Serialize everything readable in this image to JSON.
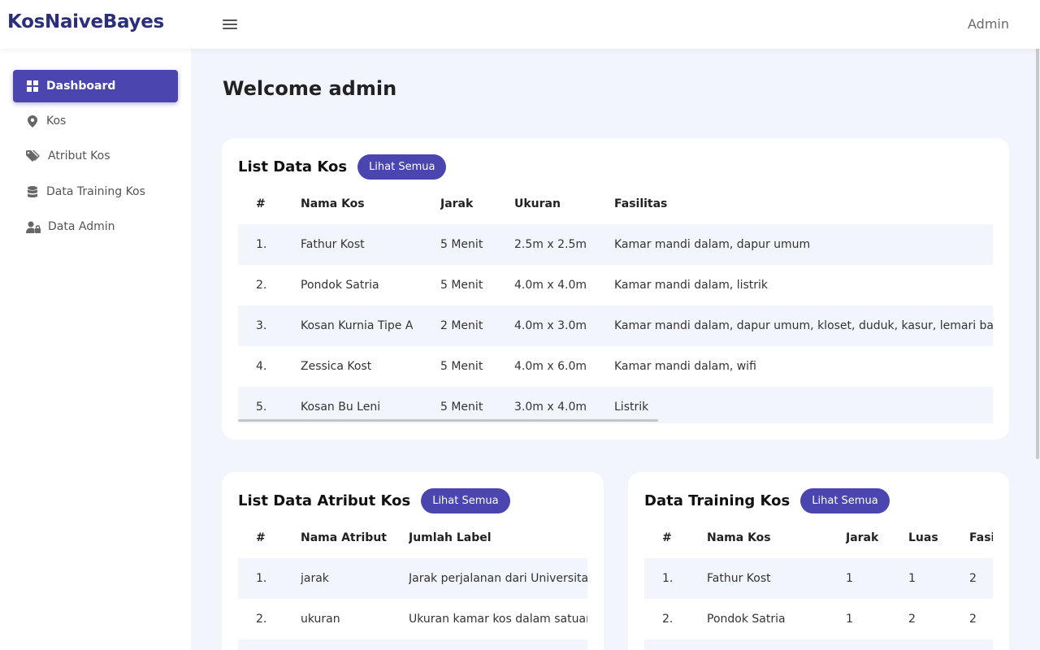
{
  "app": {
    "brand": "KosNaiveBayes",
    "user": "Admin"
  },
  "sidebar": {
    "items": [
      {
        "label": "Dashboard",
        "icon": "dashboard-icon"
      },
      {
        "label": "Kos",
        "icon": "map-marker-icon"
      },
      {
        "label": "Atribut Kos",
        "icon": "tags-icon"
      },
      {
        "label": "Data Training Kos",
        "icon": "database-icon"
      },
      {
        "label": "Data Admin",
        "icon": "user-lock-icon"
      }
    ]
  },
  "page": {
    "title": "Welcome admin"
  },
  "kos_card": {
    "title": "List Data Kos",
    "button": "Lihat Semua",
    "headers": [
      "#",
      "Nama Kos",
      "Jarak",
      "Ukuran",
      "Fasilitas"
    ],
    "rows": [
      [
        "1.",
        "Fathur Kost",
        "5 Menit",
        "2.5m x 2.5m",
        "Kamar mandi dalam, dapur umum"
      ],
      [
        "2.",
        "Pondok Satria",
        "5 Menit",
        "4.0m x 4.0m",
        "Kamar mandi dalam, listrik"
      ],
      [
        "3.",
        "Kosan Kurnia Tipe A",
        "2 Menit",
        "4.0m x 3.0m",
        "Kamar mandi dalam, dapur umum, kloset, duduk, kasur, lemari baju"
      ],
      [
        "4.",
        "Zessica Kost",
        "5 Menit",
        "4.0m x 6.0m",
        "Kamar mandi dalam, wifi"
      ],
      [
        "5.",
        "Kosan Bu Leni",
        "5 Menit",
        "3.0m x 4.0m",
        "Listrik"
      ]
    ]
  },
  "atribut_card": {
    "title": "List Data Atribut Kos",
    "button": "Lihat Semua",
    "headers": [
      "#",
      "Nama Atribut",
      "Jumlah Label"
    ],
    "rows": [
      [
        "1.",
        "jarak",
        "Jarak perjalanan dari Universitas ke"
      ],
      [
        "2.",
        "ukuran",
        "Ukuran kamar kos dalam satuan luas"
      ]
    ]
  },
  "training_card": {
    "title": "Data Training Kos",
    "button": "Lihat Semua",
    "headers": [
      "#",
      "Nama Kos",
      "Jarak",
      "Luas",
      "Fasilitas"
    ],
    "rows": [
      [
        "1.",
        "Fathur Kost",
        "1",
        "1",
        "2"
      ],
      [
        "2.",
        "Pondok Satria",
        "1",
        "2",
        "2"
      ]
    ]
  },
  "colors": {
    "primary": "#4b45b0",
    "brand": "#2b2f7a",
    "background": "#f3f5fd",
    "row_shade": "#f3f5fd"
  }
}
